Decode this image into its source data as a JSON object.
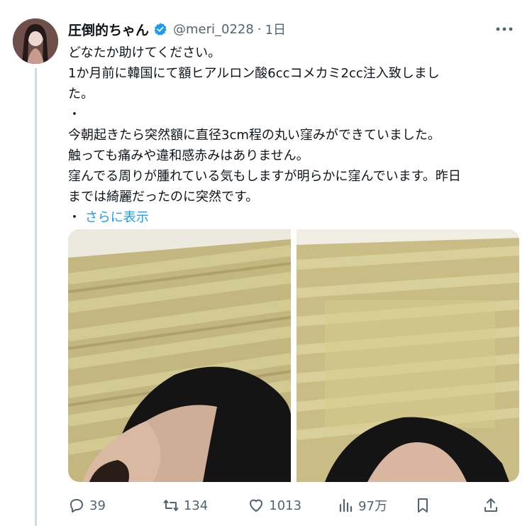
{
  "tweet": {
    "display_name": "圧倒的ちゃん",
    "handle": "@meri_0228",
    "separator": "·",
    "time": "1日",
    "lines": [
      "どなたか助けてください。",
      "1か月前に韓国にて額ヒアルロン酸6ccコメカミ2cc注入致しまし",
      "た。",
      "・",
      "今朝起きたら突然額に直径3cm程の丸い窪みができていました。",
      "触っても痛みや違和感赤みはありません。",
      "窪んでる周りが腫れている気もしますが明らかに窪んでいます。昨日",
      "までは綺麗だったのに突然です。"
    ],
    "bullet": "・",
    "show_more": "さらに表示"
  },
  "actions": {
    "reply_count": "39",
    "retweet_count": "134",
    "like_count": "1013",
    "views_count": "97万"
  },
  "colors": {
    "accent": "#1d9bf0",
    "muted": "#536471",
    "text": "#0f1419",
    "thread_line": "#cfd9de"
  },
  "icons": [
    "verified-badge-icon",
    "more-icon",
    "reply-icon",
    "retweet-icon",
    "like-icon",
    "views-icon",
    "bookmark-icon",
    "share-icon"
  ]
}
